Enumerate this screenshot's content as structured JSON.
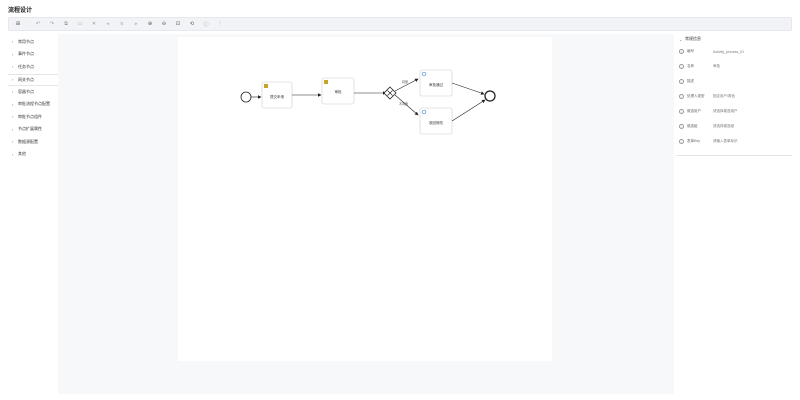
{
  "title": "流程设计",
  "toolbar": {
    "buttons": [
      {
        "name": "open-file-icon",
        "glyph": "⊞"
      },
      {
        "name": "undo-icon",
        "glyph": "↶"
      },
      {
        "name": "redo-icon",
        "glyph": "↷"
      },
      {
        "name": "copy-icon",
        "glyph": "⧉"
      },
      {
        "name": "paste-icon",
        "glyph": "▭"
      },
      {
        "name": "delete-icon",
        "glyph": "✕"
      },
      {
        "name": "align-left-icon",
        "glyph": "⫷"
      },
      {
        "name": "align-center-icon",
        "glyph": "≡"
      },
      {
        "name": "align-right-icon",
        "glyph": "⫸"
      },
      {
        "name": "zoom-in-icon",
        "glyph": "⊕"
      },
      {
        "name": "zoom-out-icon",
        "glyph": "⊖"
      },
      {
        "name": "zoom-fit-icon",
        "glyph": "⊡"
      },
      {
        "name": "reset-icon",
        "glyph": "⟲"
      },
      {
        "name": "info-icon",
        "glyph": "ⓘ"
      },
      {
        "name": "more-icon",
        "glyph": "⋮"
      }
    ]
  },
  "sidebar": {
    "items": [
      {
        "label": "常用节点"
      },
      {
        "label": "事件节点"
      },
      {
        "label": "任务节点"
      },
      {
        "label": "网关节点"
      },
      {
        "label": "容器节点"
      },
      {
        "label": "审批流程节点配置"
      },
      {
        "label": "审批节点组件"
      },
      {
        "label": "节点扩展属性"
      },
      {
        "label": "数据源配置"
      },
      {
        "label": "其他"
      }
    ]
  },
  "diagram": {
    "nodes": {
      "task1": "提交申请",
      "task2": "审批",
      "task3": "审批通过",
      "task4": "驳回修改"
    },
    "flows": {
      "flow_yes": "同意",
      "flow_no": "不同意"
    }
  },
  "panel": {
    "section_title": "常规信息",
    "rows": [
      {
        "icon": "id-icon",
        "label": "编号",
        "value": "Activity_process_01"
      },
      {
        "icon": "name-icon",
        "label": "名称",
        "value": "审批"
      },
      {
        "icon": "doc-icon",
        "label": "描述",
        "value": ""
      },
      {
        "icon": "assignee-icon",
        "label": "处理人类型",
        "value": "指定用户/角色"
      },
      {
        "icon": "candidate-icon",
        "label": "候选用户",
        "value": "请选择候选用户"
      },
      {
        "icon": "group-icon",
        "label": "候选组",
        "value": "请选择候选组"
      },
      {
        "icon": "form-icon",
        "label": "表单Key",
        "value": "请输入表单标识"
      }
    ]
  },
  "colors": {
    "accent": "#4d8fd8",
    "task_icon": "#c9a227",
    "stroke": "#222222"
  }
}
